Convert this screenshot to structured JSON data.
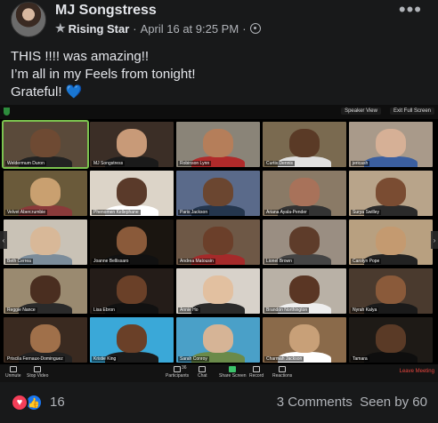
{
  "post": {
    "author": "MJ Songstress",
    "badge": "Rising Star",
    "separator": "·",
    "timestamp": "April 16 at 9:25 PM",
    "separator2": "·",
    "text_lines": [
      "THIS !!!! was amazing!!",
      "I’m all in my Feels from tonight!",
      "Grateful! "
    ],
    "heart_emoji": "💙"
  },
  "zoom": {
    "top_controls": [
      "Speaker View",
      "Exit Full Screen"
    ],
    "participants": [
      {
        "name": "Weldermum Duron",
        "bg": "#5a4a3a",
        "skin": "#6e4a33",
        "shirt": "#222222"
      },
      {
        "name": "MJ Songstress",
        "bg": "#3b2e26",
        "skin": "#c89a78",
        "shirt": "#1a1a1a"
      },
      {
        "name": "Robinson Lynn",
        "bg": "#8a8478",
        "skin": "#b57e5a",
        "shirt": "#b02a2a"
      },
      {
        "name": "Curtis Dennis",
        "bg": "#7a6a50",
        "skin": "#5a3a26",
        "shirt": "#e0e0e0"
      },
      {
        "name": "jericash",
        "bg": "#a99a8a",
        "skin": "#d6b096",
        "shirt": "#3b5fa0"
      },
      {
        "name": "Velvet Abercrumbie",
        "bg": "#6a5a3a",
        "skin": "#c9a070",
        "shirt": "#8a3a3a"
      },
      {
        "name": "Phenomen Kellephane",
        "bg": "#dcd4c8",
        "skin": "#5a3a2a",
        "shirt": "#ffffff"
      },
      {
        "name": "Paris Jackson",
        "bg": "#5a6a8a",
        "skin": "#6b4630",
        "shirt": "#24364e"
      },
      {
        "name": "Ariana Ayala-Pender",
        "bg": "#8a7a66",
        "skin": "#a8725a",
        "shirt": "#333333"
      },
      {
        "name": "Surya Swilley",
        "bg": "#b8a48a",
        "skin": "#7a4c32",
        "shirt": "#2a2a2a"
      },
      {
        "name": "Beth Cerrea",
        "bg": "#c9c2b6",
        "skin": "#d8b898",
        "shirt": "#7b8c9a"
      },
      {
        "name": "Joanne Bellissaro",
        "bg": "#1a1510",
        "skin": "#8a5a3a",
        "shirt": "#111111"
      },
      {
        "name": "Andrea Matousin",
        "bg": "#6e5846",
        "skin": "#6b3f2a",
        "shirt": "#a52a2a"
      },
      {
        "name": "Lionel Brown",
        "bg": "#9a8e82",
        "skin": "#5e3c2a",
        "shirt": "#444444"
      },
      {
        "name": "Carolyn Pope",
        "bg": "#b8a080",
        "skin": "#c49a70",
        "shirt": "#222222"
      },
      {
        "name": "Reggie Nance",
        "bg": "#9a8a70",
        "skin": "#4a2e20",
        "shirt": "#2a2a2a"
      },
      {
        "name": "Lisa Ebron",
        "bg": "#241c18",
        "skin": "#6a4028",
        "shirt": "#111111"
      },
      {
        "name": "Annie Ho",
        "bg": "#d8d2ca",
        "skin": "#e2c0a0",
        "shirt": "#2a2a2a"
      },
      {
        "name": "Brandon Northington",
        "bg": "#b9b1a6",
        "skin": "#5a3624",
        "shirt": "#eeeeee"
      },
      {
        "name": "Nyrah Kalya",
        "bg": "#4a3a2e",
        "skin": "#8a5a3a",
        "shirt": "#1a1a1a"
      },
      {
        "name": "Priscila Fernaux-Dominguez",
        "bg": "#3a2a20",
        "skin": "#a0704a",
        "shirt": "#222222"
      },
      {
        "name": "Kristie King",
        "bg": "#3aa8d8",
        "skin": "#6a4028",
        "shirt": "#1a1a1a"
      },
      {
        "name": "Sarah Conroy",
        "bg": "#4aa0c8",
        "skin": "#d6b496",
        "shirt": "#6a8a4a"
      },
      {
        "name": "Charmah Jackson",
        "bg": "#8a6a4a",
        "skin": "#c8a078",
        "shirt": "#ffffff"
      },
      {
        "name": "Tamara",
        "bg": "#1e1a16",
        "skin": "#5a3a26",
        "shirt": "#0e0e0e"
      }
    ],
    "toolbar": [
      {
        "label": "Unmute",
        "icon": "microphone-icon"
      },
      {
        "label": "Stop Video",
        "icon": "camera-icon"
      },
      {
        "label": "Participants",
        "icon": "participants-icon"
      },
      {
        "label": "Chat",
        "icon": "chat-icon"
      },
      {
        "label": "Share Screen",
        "icon": "share-screen-icon"
      },
      {
        "label": "Record",
        "icon": "record-icon"
      },
      {
        "label": "Reactions",
        "icon": "reactions-icon"
      }
    ],
    "participant_count": "36",
    "leave_label": "Leave Meeting"
  },
  "footer": {
    "reaction_count": "16",
    "comments": "3 Comments",
    "seen_by": "Seen by 60"
  },
  "colors": {
    "background": "#18191a",
    "text_primary": "#e4e6eb",
    "text_secondary": "#b0b3b8",
    "love": "#f33e58",
    "like": "#1877f2",
    "zoom_active": "#7bc34f",
    "zoom_leave": "#e8463e"
  }
}
